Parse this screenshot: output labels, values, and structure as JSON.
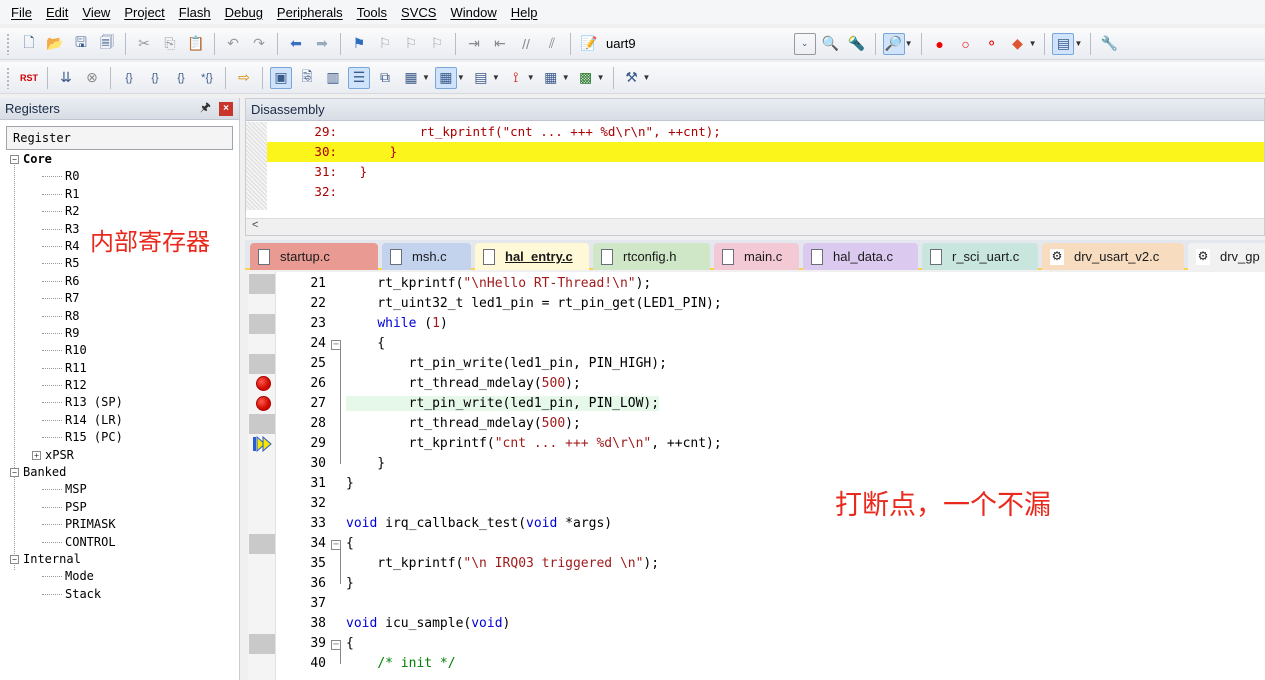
{
  "menu": [
    "File",
    "Edit",
    "View",
    "Project",
    "Flash",
    "Debug",
    "Peripherals",
    "Tools",
    "SVCS",
    "Window",
    "Help"
  ],
  "toolbar": {
    "target_name": "uart9"
  },
  "registers_panel": {
    "title": "Registers",
    "pin_glyph": "🖈",
    "close_glyph": "×",
    "column_header": "Register",
    "tree": [
      {
        "label": "Core",
        "level": 1,
        "expander": "−",
        "bold": true
      },
      {
        "label": "R0",
        "level": 2
      },
      {
        "label": "R1",
        "level": 2
      },
      {
        "label": "R2",
        "level": 2
      },
      {
        "label": "R3",
        "level": 2
      },
      {
        "label": "R4",
        "level": 2
      },
      {
        "label": "R5",
        "level": 2
      },
      {
        "label": "R6",
        "level": 2
      },
      {
        "label": "R7",
        "level": 2
      },
      {
        "label": "R8",
        "level": 2
      },
      {
        "label": "R9",
        "level": 2
      },
      {
        "label": "R10",
        "level": 2
      },
      {
        "label": "R11",
        "level": 2
      },
      {
        "label": "R12",
        "level": 2
      },
      {
        "label": "R13 (SP)",
        "level": 2
      },
      {
        "label": "R14 (LR)",
        "level": 2
      },
      {
        "label": "R15 (PC)",
        "level": 2
      },
      {
        "label": "xPSR",
        "level": 2,
        "expander": "+"
      },
      {
        "label": "Banked",
        "level": 1,
        "expander": "−"
      },
      {
        "label": "MSP",
        "level": 2
      },
      {
        "label": "PSP",
        "level": 2
      },
      {
        "label": "PRIMASK",
        "level": 2
      },
      {
        "label": "CONTROL",
        "level": 2
      },
      {
        "label": "Internal",
        "level": 1,
        "expander": "−"
      },
      {
        "label": "Mode",
        "level": 2
      },
      {
        "label": "Stack",
        "level": 2
      }
    ]
  },
  "annotations": {
    "registers_note": "内部寄存器",
    "breakpoint_note": "打断点，一个不漏"
  },
  "disassembly": {
    "title": "Disassembly",
    "scroll_glyph": "<",
    "lines": [
      {
        "num": "29:",
        "code": "        rt_kprintf(\"cnt ... +++ %d\\r\\n\", ++cnt);",
        "highlight": false
      },
      {
        "num": "30:",
        "code": "    }",
        "highlight": true
      },
      {
        "num": "31:",
        "code": "}",
        "highlight": false
      },
      {
        "num": "32:",
        "code": "",
        "highlight": false
      }
    ]
  },
  "tabs": [
    {
      "label": "startup.c",
      "color": "#e89a93",
      "selected": false,
      "icon": "file"
    },
    {
      "label": "msh.c",
      "color": "#c3d3ee",
      "selected": false,
      "icon": "file"
    },
    {
      "label": "hal_entry.c",
      "color": "#fff4c7",
      "selected": true,
      "icon": "file"
    },
    {
      "label": "rtconfig.h",
      "color": "#cfe7c7",
      "selected": false,
      "icon": "file"
    },
    {
      "label": "main.c",
      "color": "#f4c9d6",
      "selected": false,
      "icon": "file"
    },
    {
      "label": "hal_data.c",
      "color": "#dcc9ef",
      "selected": false,
      "icon": "file"
    },
    {
      "label": "r_sci_uart.c",
      "color": "#c8e6dd",
      "selected": false,
      "icon": "file"
    },
    {
      "label": "drv_usart_v2.c",
      "color": "#f7dcc0",
      "selected": false,
      "icon": "gear"
    },
    {
      "label": "drv_gp",
      "color": "#f1f1f1",
      "selected": false,
      "icon": "gear"
    }
  ],
  "colors": {
    "highlight_yellow": "#fbf51b",
    "current_line": "#e5f8ea",
    "breakpoint_red": "#e00000",
    "annotation_red": "#e8291c"
  },
  "editor": {
    "lines": [
      {
        "num": "21",
        "fold": "",
        "gutter": true,
        "html": "    rt_kprintf(<span class='str'>\"\\nHello RT-Thread!\\n\"</span>);"
      },
      {
        "num": "22",
        "fold": "",
        "gutter": false,
        "html": "    rt_uint32_t led1_pin = rt_pin_get(LED1_PIN);"
      },
      {
        "num": "23",
        "fold": "",
        "gutter": true,
        "html": "    <span class='kw'>while</span> (<span class='num'>1</span>)"
      },
      {
        "num": "24",
        "fold": "−",
        "gutter": false,
        "html": "    {"
      },
      {
        "num": "25",
        "fold": "",
        "gutter": true,
        "html": "        rt_pin_write(led1_pin, PIN_HIGH);"
      },
      {
        "num": "26",
        "fold": "",
        "gutter": true,
        "bp": true,
        "html": "        rt_thread_mdelay(<span class='num'>500</span>);"
      },
      {
        "num": "27",
        "fold": "",
        "gutter": true,
        "bp": true,
        "current": true,
        "html": "        rt_pin_write(led1_pin, PIN_LOW);"
      },
      {
        "num": "28",
        "fold": "",
        "gutter": true,
        "html": "        rt_thread_mdelay(<span class='num'>500</span>);"
      },
      {
        "num": "29",
        "fold": "",
        "gutter": true,
        "arrow": true,
        "html": "        rt_kprintf(<span class='str'>\"cnt ... +++ %d\\r\\n\"</span>, ++cnt);"
      },
      {
        "num": "30",
        "fold": "",
        "gutter": false,
        "html": "    }"
      },
      {
        "num": "31",
        "fold": "",
        "gutter": false,
        "html": "}"
      },
      {
        "num": "32",
        "fold": "",
        "gutter": false,
        "html": ""
      },
      {
        "num": "33",
        "fold": "",
        "gutter": false,
        "html": "<span class='kw'>void</span> irq_callback_test(<span class='kw'>void</span> *args)"
      },
      {
        "num": "34",
        "fold": "−",
        "gutter": true,
        "html": "{"
      },
      {
        "num": "35",
        "fold": "",
        "gutter": false,
        "html": "    rt_kprintf(<span class='str'>\"\\n IRQ03 triggered \\n\"</span>);"
      },
      {
        "num": "36",
        "fold": "",
        "gutter": false,
        "html": "}"
      },
      {
        "num": "37",
        "fold": "",
        "gutter": false,
        "html": ""
      },
      {
        "num": "38",
        "fold": "",
        "gutter": false,
        "html": "<span class='kw'>void</span> icu_sample(<span class='kw'>void</span>)"
      },
      {
        "num": "39",
        "fold": "−",
        "gutter": true,
        "html": "{"
      },
      {
        "num": "40",
        "fold": "",
        "gutter": false,
        "html": "    <span class='cmt'>/* init */</span>"
      }
    ]
  }
}
